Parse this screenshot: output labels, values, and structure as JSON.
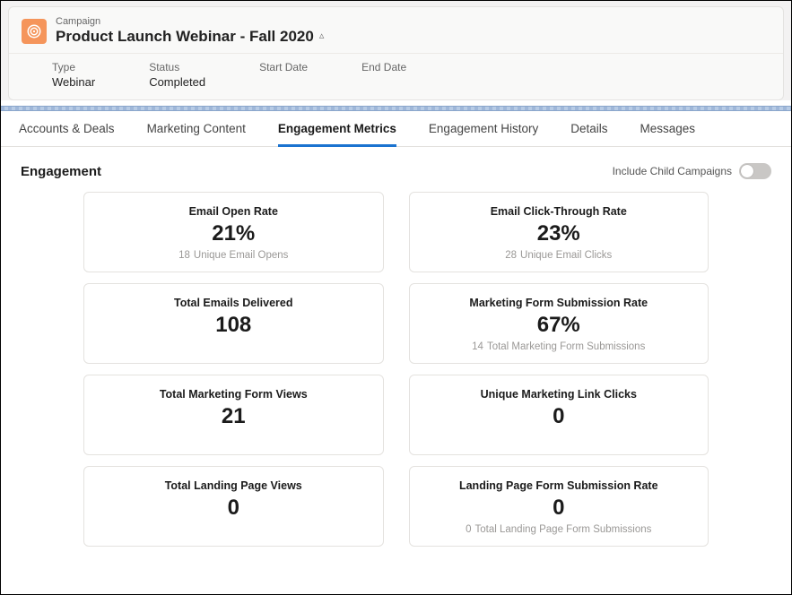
{
  "header": {
    "kicker": "Campaign",
    "title": "Product Launch Webinar - Fall 2020",
    "hierarchy_glyph": "▵",
    "meta": {
      "type_label": "Type",
      "type_value": "Webinar",
      "status_label": "Status",
      "status_value": "Completed",
      "start_label": "Start Date",
      "start_value": "",
      "end_label": "End Date",
      "end_value": ""
    }
  },
  "tabs": {
    "accounts": "Accounts & Deals",
    "marketing": "Marketing Content",
    "engagement": "Engagement Metrics",
    "history": "Engagement History",
    "details": "Details",
    "messages": "Messages"
  },
  "section": {
    "title": "Engagement",
    "toggle_label": "Include Child Campaigns"
  },
  "metrics": {
    "open_rate": {
      "title": "Email Open Rate",
      "value": "21%",
      "sub_num": "18",
      "sub_text": "Unique Email Opens"
    },
    "ctr": {
      "title": "Email Click-Through Rate",
      "value": "23%",
      "sub_num": "28",
      "sub_text": "Unique Email Clicks"
    },
    "delivered": {
      "title": "Total Emails Delivered",
      "value": "108",
      "sub_num": "",
      "sub_text": ""
    },
    "form_rate": {
      "title": "Marketing Form Submission Rate",
      "value": "67%",
      "sub_num": "14",
      "sub_text": "Total Marketing Form Submissions"
    },
    "form_views": {
      "title": "Total Marketing Form Views",
      "value": "21",
      "sub_num": "",
      "sub_text": ""
    },
    "link_clicks": {
      "title": "Unique Marketing Link Clicks",
      "value": "0",
      "sub_num": "",
      "sub_text": ""
    },
    "lp_views": {
      "title": "Total Landing Page Views",
      "value": "0",
      "sub_num": "",
      "sub_text": ""
    },
    "lp_form_rate": {
      "title": "Landing Page Form Submission Rate",
      "value": "0",
      "sub_num": "0",
      "sub_text": "Total Landing Page Form Submissions"
    }
  }
}
